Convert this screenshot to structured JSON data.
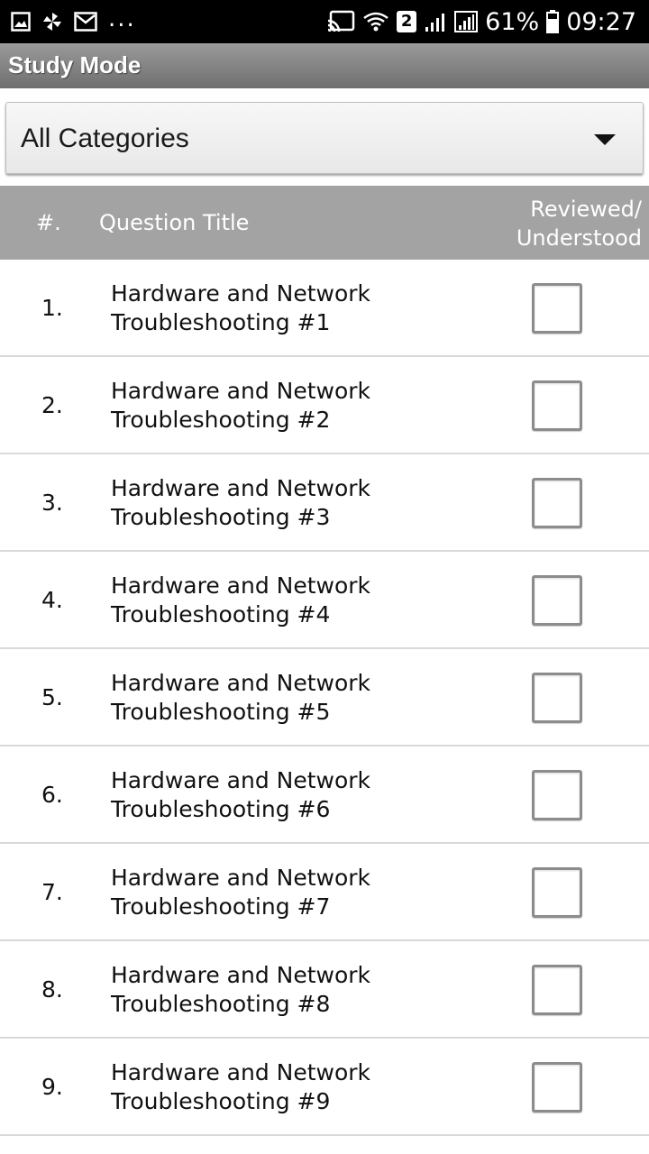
{
  "status_bar": {
    "left_icons": [
      "image-icon",
      "pinwheel-icon",
      "gmail-icon"
    ],
    "overflow": "...",
    "right_icons": [
      "cast-icon",
      "wifi-icon",
      "signal-icon",
      "signal-icon",
      "battery-icon"
    ],
    "sim_badge": "2",
    "battery": "61%",
    "time": "09:27"
  },
  "app": {
    "title": "Study Mode"
  },
  "category_select": {
    "selected": "All Categories",
    "icon": "dropdown-arrow-icon"
  },
  "table": {
    "headers": {
      "number": "#.",
      "title": "Question Title",
      "reviewed_line1": "Reviewed/",
      "reviewed_line2": "Understood"
    },
    "rows": [
      {
        "number": "1.",
        "title_line1": "Hardware and Network",
        "title_line2": "Troubleshooting #1",
        "checked": false
      },
      {
        "number": "2.",
        "title_line1": "Hardware and Network",
        "title_line2": "Troubleshooting #2",
        "checked": false
      },
      {
        "number": "3.",
        "title_line1": "Hardware and Network",
        "title_line2": "Troubleshooting #3",
        "checked": false
      },
      {
        "number": "4.",
        "title_line1": "Hardware and Network",
        "title_line2": "Troubleshooting #4",
        "checked": false
      },
      {
        "number": "5.",
        "title_line1": "Hardware and Network",
        "title_line2": "Troubleshooting #5",
        "checked": false
      },
      {
        "number": "6.",
        "title_line1": "Hardware and Network",
        "title_line2": "Troubleshooting #6",
        "checked": false
      },
      {
        "number": "7.",
        "title_line1": "Hardware and Network",
        "title_line2": "Troubleshooting #7",
        "checked": false
      },
      {
        "number": "8.",
        "title_line1": "Hardware and Network",
        "title_line2": "Troubleshooting #8",
        "checked": false
      },
      {
        "number": "9.",
        "title_line1": "Hardware and Network",
        "title_line2": "Troubleshooting #9",
        "checked": false
      }
    ]
  },
  "colors": {
    "header_bg": "#a3a3a3",
    "title_bar": "#8a8a8a",
    "divider": "#d9d9d9"
  }
}
